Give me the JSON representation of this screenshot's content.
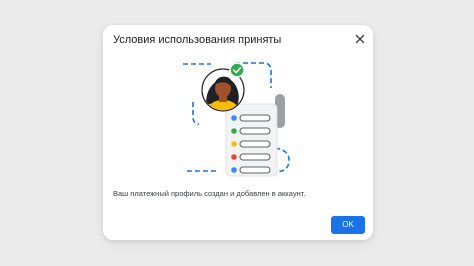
{
  "dialog": {
    "title": "Условия использования приняты",
    "message": "Ваш платежный профиль создан и добавлен в аккаунт.",
    "ok_label": "OK"
  },
  "colors": {
    "accent": "#1a73e8",
    "success": "#34a853",
    "dot_blue": "#4285f4",
    "dot_green": "#34a853",
    "dot_yellow": "#fbbc04",
    "dot_red": "#ea4335"
  },
  "icons": {
    "close": "close-icon",
    "check": "check-circle-icon"
  }
}
